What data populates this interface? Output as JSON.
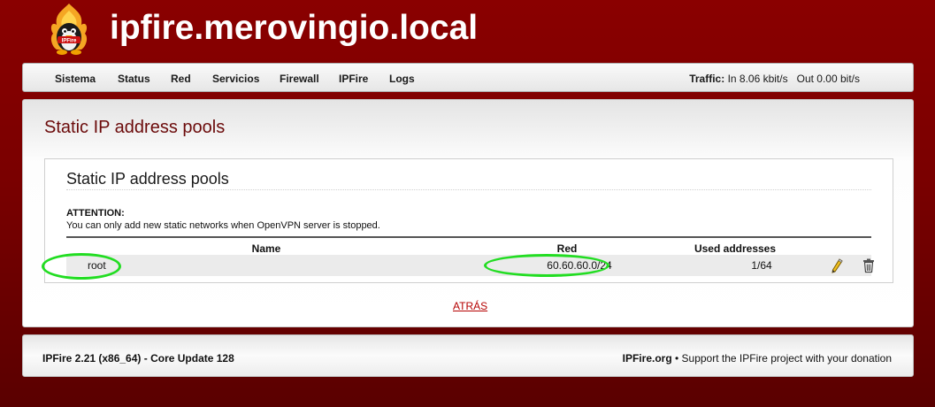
{
  "header": {
    "hostname": "ipfire.merovingio.local",
    "logo_text": "IPFire"
  },
  "nav": {
    "items": [
      {
        "label": "Sistema"
      },
      {
        "label": "Status"
      },
      {
        "label": "Red"
      },
      {
        "label": "Servicios"
      },
      {
        "label": "Firewall"
      },
      {
        "label": "IPFire"
      },
      {
        "label": "Logs"
      }
    ],
    "traffic_label": "Traffic:",
    "traffic_in": "In 8.06 kbit/s",
    "traffic_out": "Out 0.00 bit/s"
  },
  "content": {
    "page_title": "Static IP address pools",
    "box_title": "Static IP address pools",
    "attention_title": "ATTENTION:",
    "attention_text": "You can only add new static networks when OpenVPN server is stopped.",
    "table": {
      "columns": [
        "Name",
        "Red",
        "Used addresses"
      ],
      "rows": [
        {
          "name": "root",
          "red": "60.60.60.0/24",
          "used": "1/64"
        }
      ]
    },
    "back_link": "ATRÁS"
  },
  "icons": {
    "edit": "pencil-icon",
    "delete": "trash-icon"
  },
  "colors": {
    "background": "#7a0000",
    "title": "#6b0a0a",
    "link": "#b50000",
    "highlight": "#22dd22"
  },
  "footer": {
    "version": "IPFire 2.21 (x86_64) - Core Update 128",
    "brand": "IPFire.org",
    "support_text": " • Support the IPFire project with your donation"
  }
}
